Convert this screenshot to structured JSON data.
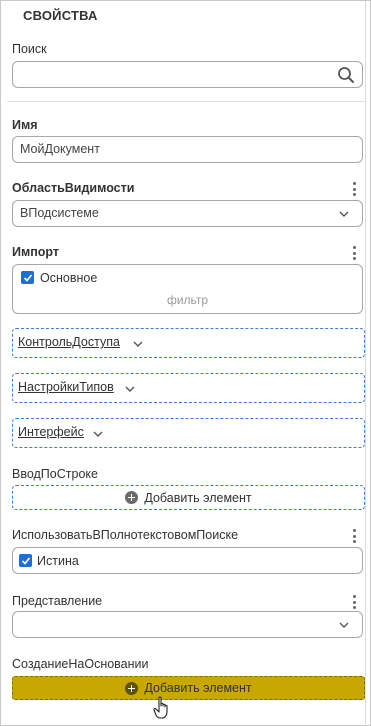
{
  "panel": {
    "title": "СВОЙСТВА"
  },
  "search": {
    "label": "Поиск",
    "value": ""
  },
  "name": {
    "label": "Имя",
    "value": "МойДокумент"
  },
  "scope": {
    "label": "ОбластьВидимости",
    "value": "ВПодсистеме"
  },
  "import": {
    "label": "Импорт",
    "checkbox_label": "Основное",
    "checked": true,
    "filter_placeholder": "фильтр"
  },
  "groups": [
    {
      "label": "КонтрольДоступа"
    },
    {
      "label": "НастройкиТипов"
    },
    {
      "label": "Интерфейс"
    }
  ],
  "input_by_string": {
    "label": "ВводПоСтроке",
    "add_label": "Добавить элемент"
  },
  "fulltext": {
    "label": "ИспользоватьВПолнотекстовомПоиске",
    "checkbox_label": "Истина",
    "checked": true
  },
  "presentation": {
    "label": "Представление",
    "value": ""
  },
  "create_on_basis": {
    "label": "СозданиеНаОсновании",
    "add_label": "Добавить элемент"
  },
  "colors": {
    "accent_blue": "#1c6fd6",
    "dashed_blue": "#3c7fd1",
    "highlight": "#c8a800"
  },
  "icons": [
    "search-icon",
    "chevron-down-icon",
    "kebab-menu-icon",
    "checkbox-checked-icon",
    "add-circle-icon",
    "hand-pointer-cursor"
  ]
}
